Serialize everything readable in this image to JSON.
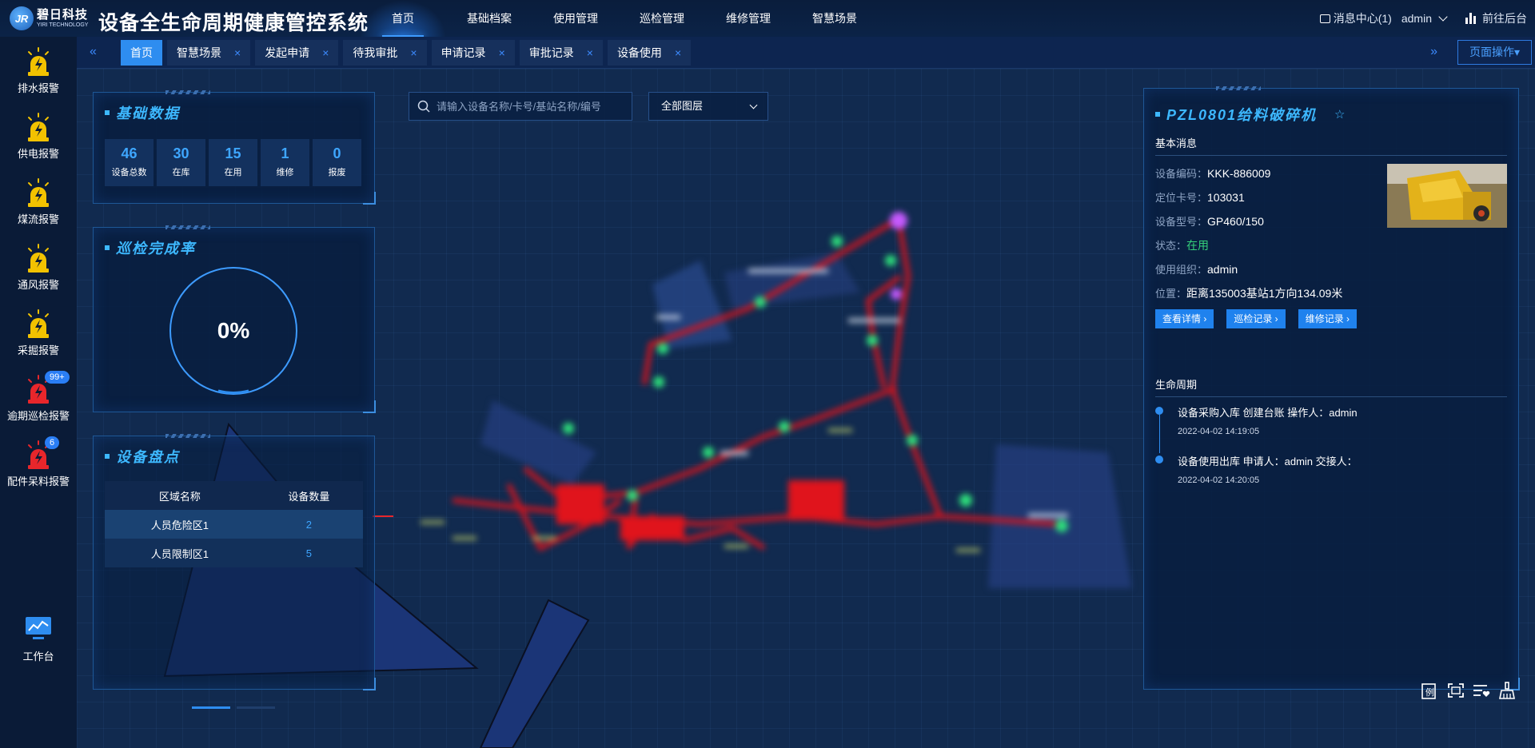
{
  "header": {
    "logo_cn": "碧日科技",
    "logo_en": "YIRI TECHNOLOGY",
    "logo_mark": "JR",
    "title": "设备全生命周期健康管控系统",
    "nav": [
      {
        "label": "首页",
        "active": true
      },
      {
        "label": "基础档案"
      },
      {
        "label": "使用管理"
      },
      {
        "label": "巡检管理"
      },
      {
        "label": "维修管理"
      },
      {
        "label": "智慧场景"
      }
    ],
    "message_center": "消息中心(1)",
    "user": "admin",
    "backend_link": "前往后台"
  },
  "sidebar": {
    "alarms": [
      {
        "label": "排水报警",
        "color": "#f2c200",
        "icon": "alarm-lamp-icon"
      },
      {
        "label": "供电报警",
        "color": "#f2c200",
        "icon": "alarm-lamp-icon"
      },
      {
        "label": "煤流报警",
        "color": "#f2c200",
        "icon": "alarm-lamp-icon"
      },
      {
        "label": "通风报警",
        "color": "#f2c200",
        "icon": "alarm-lamp-icon"
      },
      {
        "label": "采掘报警",
        "color": "#f2c200",
        "icon": "alarm-lamp-icon"
      },
      {
        "label": "逾期巡检报警",
        "color": "#e8262b",
        "icon": "alarm-lamp-icon",
        "badge": "99+"
      },
      {
        "label": "配件呆料报警",
        "color": "#e8262b",
        "icon": "alarm-lamp-icon",
        "badge": "6"
      }
    ],
    "workbench": "工作台"
  },
  "tabs": {
    "items": [
      {
        "label": "首页",
        "active": true,
        "closable": false
      },
      {
        "label": "智慧场景",
        "closable": true
      },
      {
        "label": "发起申请",
        "closable": true
      },
      {
        "label": "待我审批",
        "closable": true
      },
      {
        "label": "申请记录",
        "closable": true
      },
      {
        "label": "审批记录",
        "closable": true
      },
      {
        "label": "设备使用",
        "closable": true
      }
    ],
    "close_glyph": "×",
    "prev_glyph": "«",
    "next_glyph": "»",
    "page_ops": "页面操作▾"
  },
  "basic_data": {
    "title": "基础数据",
    "stats": [
      {
        "value": "46",
        "label": "设备总数"
      },
      {
        "value": "30",
        "label": "在库"
      },
      {
        "value": "15",
        "label": "在用"
      },
      {
        "value": "1",
        "label": "维修"
      },
      {
        "value": "0",
        "label": "报废"
      }
    ]
  },
  "inspection": {
    "title": "巡检完成率",
    "rate_text": "0%",
    "rate": 0
  },
  "inventory": {
    "title": "设备盘点",
    "columns": [
      "区域名称",
      "设备数量"
    ],
    "rows": [
      {
        "area": "人员危险区1",
        "count": "2"
      },
      {
        "area": "人员限制区1",
        "count": "5"
      }
    ]
  },
  "search": {
    "placeholder": "请输入设备名称/卡号/基站名称/编号"
  },
  "layer": {
    "selected": "全部图层"
  },
  "detail": {
    "title": "PZL0801给料破碎机",
    "star": "☆",
    "basic_section": "基本消息",
    "fields": [
      {
        "key": "设备编码：",
        "value": "KKK-886009"
      },
      {
        "key": "定位卡号：",
        "value": "103031"
      },
      {
        "key": "设备型号：",
        "value": "GP460/150"
      },
      {
        "key": "状态：",
        "value": "在用",
        "status": true
      },
      {
        "key": "使用组织：",
        "value": "admin"
      },
      {
        "key": "位置：",
        "value": "距离135003基站1方向134.09米"
      }
    ],
    "buttons": [
      "查看详情 ›",
      "巡检记录 ›",
      "维修记录 ›"
    ],
    "lifecycle_section": "生命周期",
    "timeline": [
      {
        "text": "设备采购入库 创建台账 操作人：admin",
        "time": "2022-04-02 14:19:05"
      },
      {
        "text": "设备使用出库 申请人：admin 交接人：",
        "time": "2022-04-02 14:20:05"
      }
    ]
  },
  "map_tools": [
    "legend-icon",
    "fullscreen-icon",
    "list-favorite-icon",
    "clear-icon"
  ],
  "colors": {
    "accent": "#2e8df0",
    "title_cyan": "#3db8ff",
    "alarm_yellow": "#f2c200",
    "alarm_red": "#e8262b",
    "status_green": "#35d17b"
  }
}
